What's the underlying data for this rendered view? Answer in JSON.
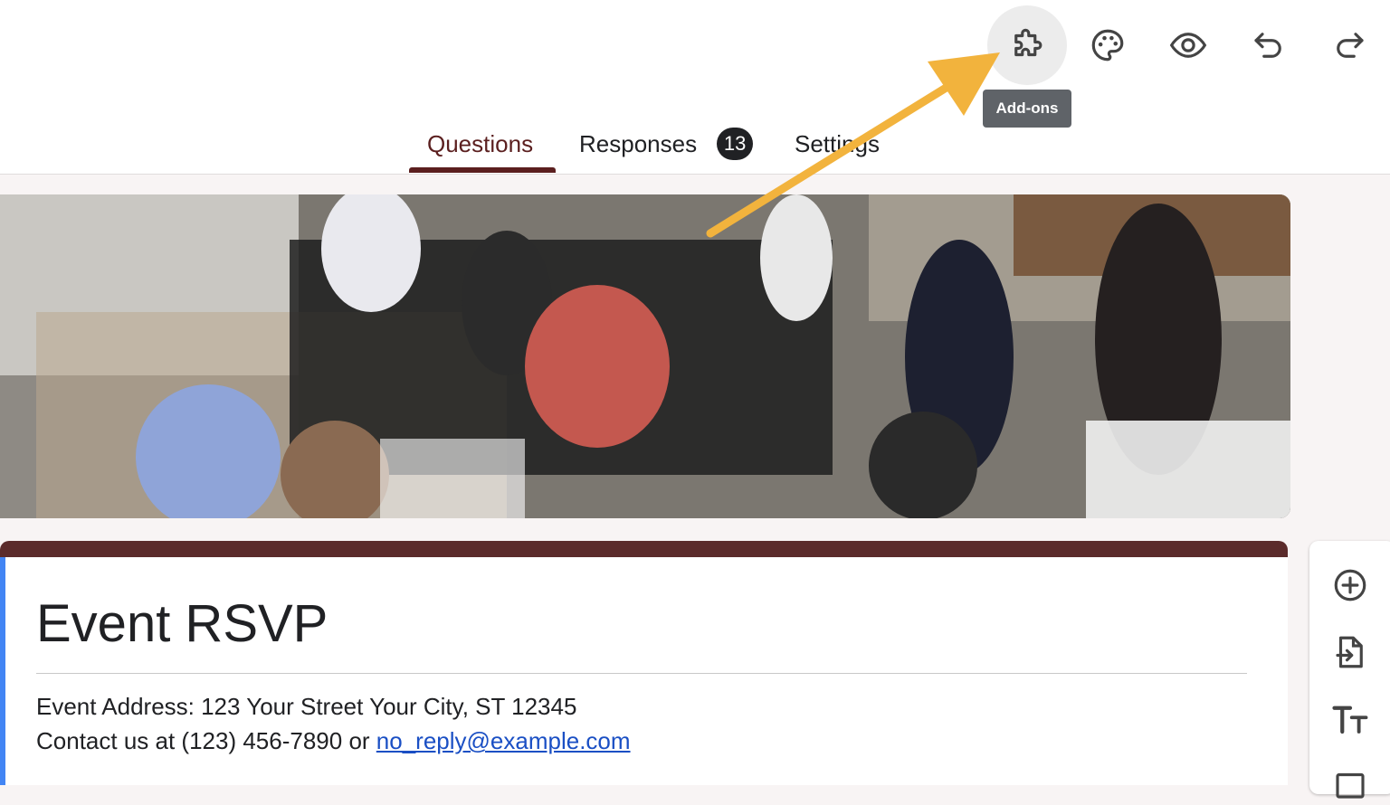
{
  "header": {
    "icons": [
      "puzzle-icon",
      "palette-icon",
      "eye-icon",
      "undo-icon",
      "redo-icon"
    ],
    "tooltip": "Add-ons"
  },
  "tabs": [
    {
      "label": "Questions",
      "selected": true
    },
    {
      "label": "Responses",
      "badge": "13"
    },
    {
      "label": "Settings"
    }
  ],
  "form": {
    "title": "Event RSVP",
    "description_line1": "Event Address: 123 Your Street Your City, ST 12345",
    "description_prefix": "Contact us at (123) 456-7890 or",
    "email": "no_reply@example.com"
  },
  "side_toolbar": {
    "icons": [
      "add-question-icon",
      "import-questions-icon",
      "add-title-icon",
      "add-image-icon"
    ]
  },
  "colors": {
    "accent": "#5b2b2b",
    "tab_accent": "#5b1f1f",
    "link": "#1a4fc4",
    "arrow": "#f2b33d",
    "badge": "#202124"
  }
}
